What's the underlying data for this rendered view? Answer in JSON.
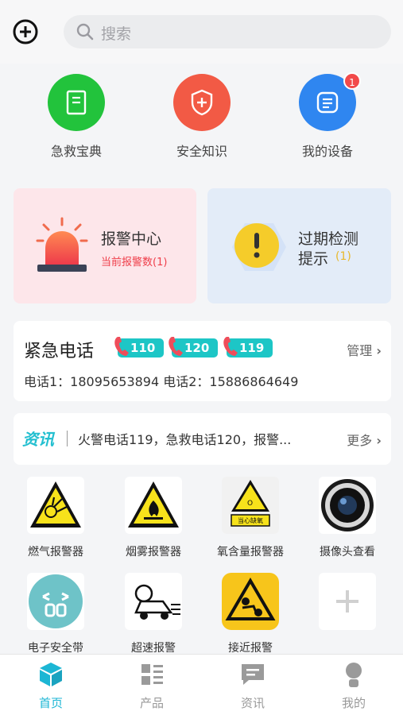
{
  "search": {
    "placeholder": "搜索"
  },
  "quick": [
    {
      "label": "急救宝典",
      "color": "#22c33c",
      "icon": "book-icon"
    },
    {
      "label": "安全知识",
      "color": "#f25a45",
      "icon": "shield-icon"
    },
    {
      "label": "我的设备",
      "color": "#2f86f0",
      "icon": "device-icon",
      "badge": "1"
    }
  ],
  "alarm": {
    "title": "报警中心",
    "sub": "当前报警数(1)"
  },
  "expire": {
    "title1": "过期检测",
    "title2": "提示",
    "count": "(1)"
  },
  "emergency": {
    "title": "紧急电话",
    "numbers": [
      "110",
      "120",
      "119"
    ],
    "manage": "管理",
    "phones": "电话1：18095653894  电话2：15886864649"
  },
  "news": {
    "logo": "资讯",
    "text": "火警电话119，急救电话120，报警...",
    "more": "更多"
  },
  "devices": [
    {
      "label": "燃气报警器",
      "icon": "gas-warning-icon"
    },
    {
      "label": "烟雾报警器",
      "icon": "fire-warning-icon"
    },
    {
      "label": "氧含量报警器",
      "icon": "oxygen-warning-icon",
      "sign_text": "当心缺氧"
    },
    {
      "label": "摄像头查看",
      "icon": "camera-icon"
    },
    {
      "label": "电子安全带",
      "icon": "seatbelt-icon"
    },
    {
      "label": "超速报警",
      "icon": "speeding-car-icon"
    },
    {
      "label": "接近报警",
      "icon": "proximity-warning-icon"
    },
    {
      "label": "",
      "icon": "add-icon"
    }
  ],
  "tabs": [
    {
      "label": "首页",
      "icon": "home-cube-icon",
      "active": true
    },
    {
      "label": "产品",
      "icon": "product-grid-icon"
    },
    {
      "label": "资讯",
      "icon": "message-icon"
    },
    {
      "label": "我的",
      "icon": "profile-icon"
    }
  ],
  "colors": {
    "accent": "#1cb6d4",
    "alarm_red": "#f24a4a",
    "pill": "#1dc6c6"
  }
}
